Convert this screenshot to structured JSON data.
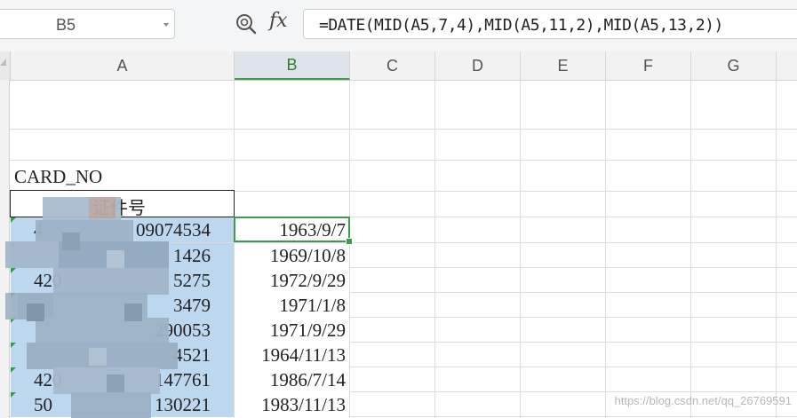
{
  "formula_bar": {
    "name_box": "B5",
    "fx_label": "fx",
    "formula": "=DATE(MID(A5,7,4),MID(A5,11,2),MID(A5,13,2))"
  },
  "columns": [
    "A",
    "B",
    "C",
    "D",
    "E",
    "F",
    "G"
  ],
  "selected_column": "B",
  "sheet": {
    "a3": "CARD_NO",
    "a4": "证件号",
    "rows": [
      {
        "a": "4",
        "a_tail": "09074534",
        "b": "1963/9/7"
      },
      {
        "a": "",
        "a_tail": "1426",
        "b": "1969/10/8"
      },
      {
        "a": "420",
        "a_tail": "5275",
        "b": "1972/9/29"
      },
      {
        "a": "",
        "a_tail": "3479",
        "b": "1971/1/8"
      },
      {
        "a": "",
        "a_tail": "290053",
        "b": "1971/9/29"
      },
      {
        "a": "",
        "a_tail": "4521",
        "b": "1964/11/13"
      },
      {
        "a": "420",
        "a_tail": "147761",
        "b": "1986/7/14"
      },
      {
        "a": "50",
        "a_tail": "130221",
        "b": "1983/11/13"
      }
    ]
  },
  "watermark": "https://blog.csdn.net/qq_26769591",
  "colors": {
    "selection_fill": "#bdd7ee",
    "active_border": "#3f9b4b",
    "header_bg": "#f2f2f2"
  }
}
